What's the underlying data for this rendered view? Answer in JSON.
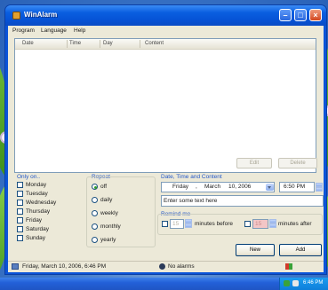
{
  "window": {
    "title": "WinAlarm"
  },
  "menu": [
    "Program",
    "Language",
    "Help"
  ],
  "list": {
    "columns": [
      "Date",
      "Time",
      "Day",
      "Content"
    ]
  },
  "buttons": {
    "edit": "Edit",
    "delete": "Delete",
    "new": "New",
    "add": "Add"
  },
  "only_on": {
    "title": "Only on..",
    "days": [
      "Monday",
      "Tuesday",
      "Wednesday",
      "Thursday",
      "Friday",
      "Saturday",
      "Sunday"
    ]
  },
  "repeat": {
    "title": "Repeat",
    "options": [
      "off",
      "daily",
      "weekly",
      "monthly",
      "yearly"
    ],
    "selected": "off"
  },
  "datetime": {
    "title": "Date, Time and Content",
    "day": "Friday",
    "sep": ",",
    "month": "March",
    "date": "10, 2006",
    "time": "6:50 PM",
    "content_value": "Enter some text here"
  },
  "remind": {
    "title": "Remind me",
    "before_value": "15",
    "before_label": "minutes before",
    "after_value": "15",
    "after_label": "minutes after"
  },
  "status": {
    "datetime": "Friday, March 10, 2006, 6:46 PM",
    "alarms": "No alarms"
  },
  "taskbar": {
    "time": "6:46 PM"
  },
  "colors": {
    "title_blue": "#0653d6",
    "group_title": "#2558c8",
    "face": "#ece9d8"
  }
}
